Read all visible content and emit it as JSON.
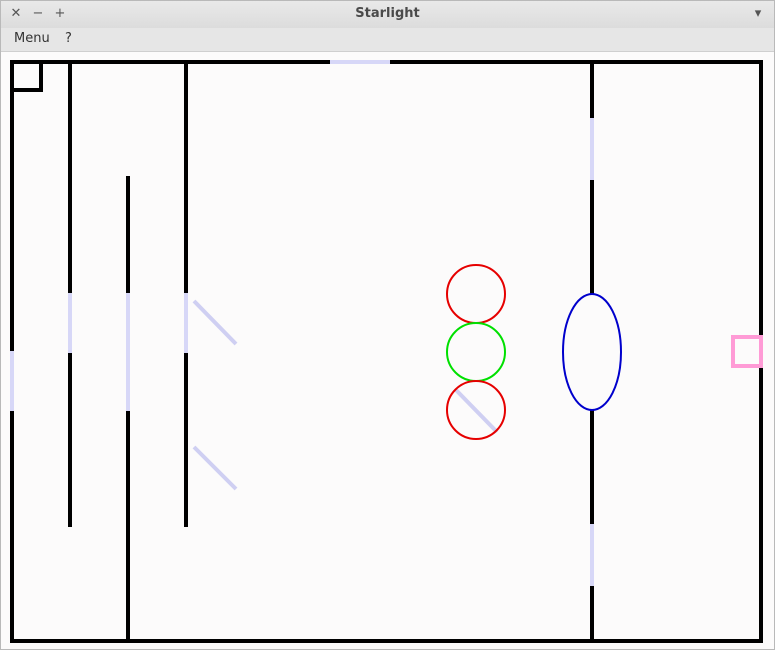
{
  "window": {
    "title": "Starlight",
    "controls": {
      "close": "✕",
      "minimize": "−",
      "maximize": "+",
      "dropdown": "▾"
    }
  },
  "menubar": {
    "items": [
      "Menu",
      "?"
    ]
  },
  "colors": {
    "wall": "#000000",
    "glass": "#d7d7f7",
    "mirror": "#cfcff2",
    "red_ring": "#e60000",
    "green_ring": "#00e000",
    "blue_ellipse": "#0000cc",
    "goal": "#ff9bd6",
    "background": "#fcfbfb"
  },
  "icons": {
    "close": "close-icon",
    "minimize": "minimize-icon",
    "maximize": "maximize-icon",
    "dropdown": "chevron-down-icon"
  }
}
